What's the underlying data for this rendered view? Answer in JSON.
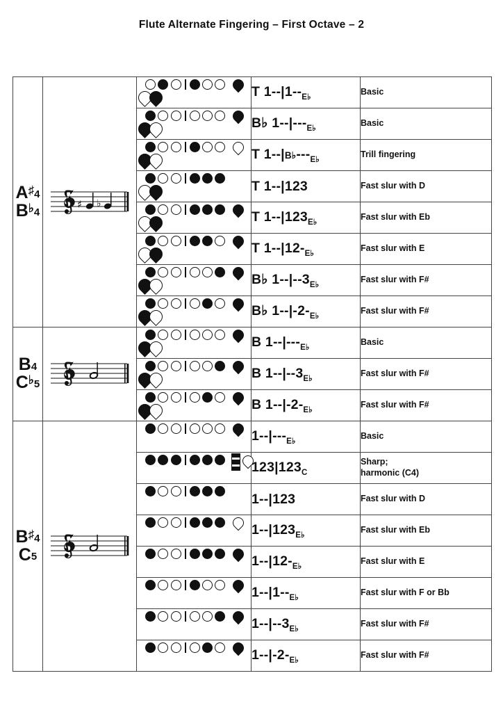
{
  "document": {
    "title": "Flute Alternate Fingering – First Octave – 2"
  },
  "groups": [
    {
      "note_top": "A",
      "note_top_acc": "♯",
      "note_top_oct": "4",
      "note_bot": "B",
      "note_bot_acc": "♭",
      "note_bot_oct": "4",
      "staff": "treble-staff-two-notes",
      "rows": [
        {
          "notation": "T 1--|1--",
          "sub": "E♭",
          "desc": "Basic"
        },
        {
          "notation": "B♭ 1--|---",
          "sub": "E♭",
          "desc": "Basic"
        },
        {
          "notation": "T 1--|",
          "mid": "B♭",
          "notation2": "---",
          "sub": "E♭",
          "desc": "Trill fingering"
        },
        {
          "notation": "T 1--|123",
          "sub": "",
          "desc": "Fast slur with D"
        },
        {
          "notation": "T 1--|123",
          "sub": "E♭",
          "desc": "Fast slur with Eb"
        },
        {
          "notation": "T 1--|12-",
          "sub": "E♭",
          "desc": "Fast slur with E"
        },
        {
          "notation": "B♭ 1--|--3",
          "sub": "E♭",
          "desc": "Fast slur with F#"
        },
        {
          "notation": "B♭ 1--|-2-",
          "sub": "E♭",
          "desc": "Fast slur with F#"
        }
      ]
    },
    {
      "note_top": "B",
      "note_top_acc": "",
      "note_top_oct": "4",
      "note_bot": "C",
      "note_bot_acc": "♭",
      "note_bot_oct": "5",
      "staff": "treble-staff-one-note",
      "rows": [
        {
          "notation": "B 1--|---",
          "sub": "E♭",
          "desc": "Basic"
        },
        {
          "notation": "B 1--|--3",
          "sub": "E♭",
          "desc": "Fast slur with F#"
        },
        {
          "notation": "B 1--|-2-",
          "sub": "E♭",
          "desc": "Fast slur with F#"
        }
      ]
    },
    {
      "note_top": "B",
      "note_top_acc": "♯",
      "note_top_oct": "4",
      "note_bot": "C",
      "note_bot_acc": "",
      "note_bot_oct": "5",
      "staff": "treble-staff-one-note",
      "rows": [
        {
          "notation": "1--|---",
          "sub": "E♭",
          "desc": "Basic"
        },
        {
          "notation": "123|123",
          "sub": "C",
          "desc": "Sharp;\nharmonic (C4)"
        },
        {
          "notation": "1--|123",
          "sub": "",
          "desc": "Fast slur with D"
        },
        {
          "notation": "1--|123",
          "sub": "E♭",
          "desc": "Fast slur with Eb"
        },
        {
          "notation": "1--|12-",
          "sub": "E♭",
          "desc": "Fast slur with E"
        },
        {
          "notation": "1--|1--",
          "sub": "E♭",
          "desc": "Fast slur with F or Bb"
        },
        {
          "notation": "1--|--3",
          "sub": "E♭",
          "desc": "Fast slur with F#"
        },
        {
          "notation": "1--|-2-",
          "sub": "E♭",
          "desc": "Fast slur with F#"
        }
      ]
    }
  ],
  "fingerings": [
    {
      "id": "g1r1",
      "holes": [
        "open",
        "closed",
        "open",
        "bar",
        "closed",
        "open",
        "open"
      ],
      "right_key": "filled",
      "low_keys": [
        "open",
        "filled"
      ]
    },
    {
      "id": "g1r2",
      "holes": [
        "closed",
        "open",
        "open",
        "bar",
        "open",
        "open",
        "open"
      ],
      "right_key": "filled",
      "low_keys": [
        "filled",
        "open"
      ]
    },
    {
      "id": "g1r3",
      "holes": [
        "closed",
        "open",
        "open",
        "bar",
        "closed",
        "open",
        "open"
      ],
      "right_key": "open",
      "low_keys": [
        "filled",
        "open"
      ]
    },
    {
      "id": "g1r4",
      "holes": [
        "closed",
        "open",
        "open",
        "bar",
        "closed",
        "closed",
        "closed"
      ],
      "right_key": "none",
      "low_keys": [
        "open",
        "filled"
      ]
    },
    {
      "id": "g1r5",
      "holes": [
        "closed",
        "open",
        "open",
        "bar",
        "closed",
        "closed",
        "closed"
      ],
      "right_key": "filled",
      "low_keys": [
        "open",
        "filled"
      ]
    },
    {
      "id": "g1r6",
      "holes": [
        "closed",
        "open",
        "open",
        "bar",
        "closed",
        "closed",
        "open"
      ],
      "right_key": "filled",
      "low_keys": [
        "open",
        "filled"
      ]
    },
    {
      "id": "g1r7",
      "holes": [
        "closed",
        "open",
        "open",
        "bar",
        "open",
        "open",
        "closed"
      ],
      "right_key": "filled",
      "low_keys": [
        "filled",
        "open"
      ]
    },
    {
      "id": "g1r8",
      "holes": [
        "closed",
        "open",
        "open",
        "bar",
        "open",
        "closed",
        "open"
      ],
      "right_key": "filled",
      "low_keys": [
        "filled",
        "open"
      ]
    },
    {
      "id": "g2r1",
      "holes": [
        "closed",
        "open",
        "open",
        "bar",
        "open",
        "open",
        "open"
      ],
      "right_key": "filled",
      "low_keys": [
        "filled",
        "open"
      ]
    },
    {
      "id": "g2r2",
      "holes": [
        "closed",
        "open",
        "open",
        "bar",
        "open",
        "open",
        "closed"
      ],
      "right_key": "filled",
      "low_keys": [
        "filled",
        "open"
      ]
    },
    {
      "id": "g2r3",
      "holes": [
        "closed",
        "open",
        "open",
        "bar",
        "open",
        "closed",
        "open"
      ],
      "right_key": "filled",
      "low_keys": [
        "filled",
        "open"
      ]
    },
    {
      "id": "g3r1",
      "holes": [
        "closed",
        "open",
        "open",
        "bar",
        "open",
        "open",
        "open"
      ],
      "right_key": "filled",
      "low_keys": []
    },
    {
      "id": "g3r2",
      "holes": [
        "closed",
        "closed",
        "closed",
        "bar",
        "closed",
        "closed",
        "closed"
      ],
      "right_key": "ckey",
      "low_keys": []
    },
    {
      "id": "g3r3",
      "holes": [
        "closed",
        "open",
        "open",
        "bar",
        "closed",
        "closed",
        "closed"
      ],
      "right_key": "none",
      "low_keys": []
    },
    {
      "id": "g3r4",
      "holes": [
        "closed",
        "open",
        "open",
        "bar",
        "closed",
        "closed",
        "closed"
      ],
      "right_key": "open",
      "low_keys": []
    },
    {
      "id": "g3r5",
      "holes": [
        "closed",
        "open",
        "open",
        "bar",
        "closed",
        "closed",
        "closed"
      ],
      "right_key": "filled",
      "low_keys": []
    },
    {
      "id": "g3r6",
      "holes": [
        "closed",
        "open",
        "open",
        "bar",
        "closed",
        "open",
        "open"
      ],
      "right_key": "filled",
      "low_keys": []
    },
    {
      "id": "g3r7",
      "holes": [
        "closed",
        "open",
        "open",
        "bar",
        "open",
        "open",
        "closed"
      ],
      "right_key": "filled",
      "low_keys": []
    },
    {
      "id": "g3r8",
      "holes": [
        "closed",
        "open",
        "open",
        "bar",
        "open",
        "closed",
        "open"
      ],
      "right_key": "filled",
      "low_keys": []
    }
  ]
}
